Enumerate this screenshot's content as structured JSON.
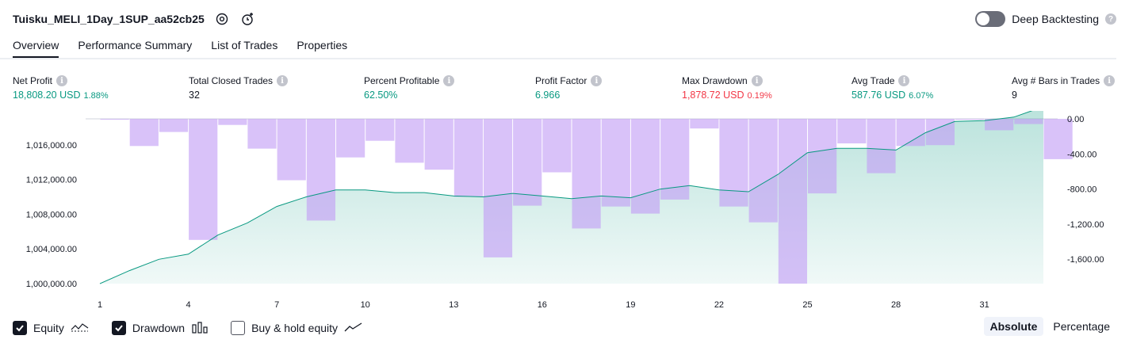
{
  "header": {
    "strategy_name": "Tuisku_MELI_1Day_1SUP_aa52cb25"
  },
  "deep_backtesting": {
    "label": "Deep Backtesting",
    "enabled": false
  },
  "tabs": [
    {
      "label": "Overview",
      "active": true
    },
    {
      "label": "Performance Summary",
      "active": false
    },
    {
      "label": "List of Trades",
      "active": false
    },
    {
      "label": "Properties",
      "active": false
    }
  ],
  "metrics": {
    "net_profit": {
      "label": "Net Profit",
      "value": "18,808.20 USD",
      "pct": "1.88%"
    },
    "total_closed_trades": {
      "label": "Total Closed Trades",
      "value": "32"
    },
    "percent_profitable": {
      "label": "Percent Profitable",
      "value": "62.50%"
    },
    "profit_factor": {
      "label": "Profit Factor",
      "value": "6.966"
    },
    "max_drawdown": {
      "label": "Max Drawdown",
      "value": "1,878.72 USD",
      "pct": "0.19%"
    },
    "avg_trade": {
      "label": "Avg Trade",
      "value": "587.76 USD",
      "pct": "6.07%"
    },
    "avg_bars": {
      "label": "Avg # Bars in Trades",
      "value": "9"
    }
  },
  "chart_data": {
    "type": "line+bar",
    "x": [
      1,
      2,
      3,
      4,
      5,
      6,
      7,
      8,
      9,
      10,
      11,
      12,
      13,
      14,
      15,
      16,
      17,
      18,
      19,
      20,
      21,
      22,
      23,
      24,
      25,
      26,
      27,
      28,
      29,
      30,
      31,
      32,
      33
    ],
    "x_ticks": [
      "1",
      "4",
      "7",
      "10",
      "13",
      "16",
      "19",
      "22",
      "25",
      "28",
      "31"
    ],
    "left_axis": {
      "ylim": [
        1000000,
        1019000
      ],
      "ticks": [
        "1,000,000.00",
        "1,004,000.00",
        "1,008,000.00",
        "1,012,000.00",
        "1,016,000.00"
      ]
    },
    "right_axis": {
      "ylim": [
        -1878.72,
        0
      ],
      "ticks": [
        "0.00",
        "-400.00",
        "-800.00",
        "-1,200.00",
        "-1,600.00"
      ]
    },
    "series": [
      {
        "name": "Equity",
        "values": [
          1000000,
          1001500,
          1002800,
          1003400,
          1005600,
          1007000,
          1008900,
          1010000,
          1010800,
          1010800,
          1010500,
          1010500,
          1010100,
          1010000,
          1010400,
          1010100,
          1009800,
          1010100,
          1009900,
          1010900,
          1011300,
          1010800,
          1010600,
          1012600,
          1015100,
          1015600,
          1015600,
          1015400,
          1017400,
          1018700,
          1018800,
          1019200,
          1020400
        ]
      },
      {
        "name": "Drawdown",
        "values": [
          -5,
          -310,
          -150,
          -1380,
          -70,
          -340,
          -700,
          -1160,
          -440,
          -250,
          -500,
          -580,
          -890,
          -1580,
          -990,
          -610,
          -1250,
          -1000,
          -1080,
          -920,
          -110,
          -1000,
          -1180,
          -1878.72,
          -850,
          -280,
          -620,
          -310,
          -300,
          0,
          -130,
          -60,
          -460
        ]
      }
    ],
    "equity_color": "#089981",
    "drawdown_color": "#c29cf5"
  },
  "legend": {
    "equity": {
      "label": "Equity",
      "checked": true
    },
    "drawdown": {
      "label": "Drawdown",
      "checked": true
    },
    "buy_hold": {
      "label": "Buy & hold equity",
      "checked": false
    }
  },
  "mode": {
    "absolute": "Absolute",
    "percentage": "Percentage"
  }
}
